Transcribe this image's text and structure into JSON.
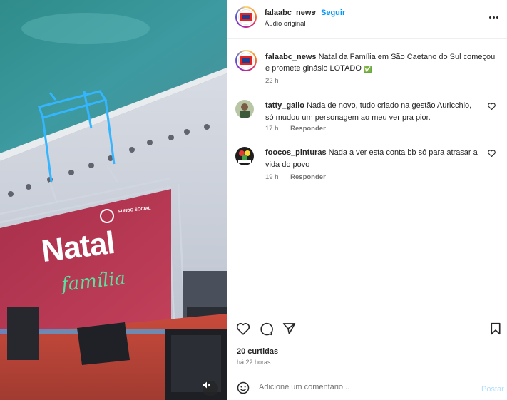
{
  "post": {
    "username": "falaabc_news",
    "separator": "•",
    "follow_label": "Seguir",
    "audio_label": "Áudio original"
  },
  "caption": {
    "username": "falaabc_news",
    "text": "Natal da Família em São Caetano do Sul começou e promete ginásio LOTADO",
    "emoji": "✅",
    "time": "22 h"
  },
  "comments": [
    {
      "username": "tatty_gallo",
      "text": "Nada de novo, tudo criado na gestão Auricchio, só mudou um personagem ao meu ver pra pior.",
      "time": "17 h",
      "reply_label": "Responder"
    },
    {
      "username": "foocos_pinturas",
      "text": "Nada a ver esta conta bb só para atrasar a vida do povo",
      "time": "19 h",
      "reply_label": "Responder"
    }
  ],
  "stats": {
    "likes": "20 curtidas",
    "posted_ago": "há 22 horas"
  },
  "composer": {
    "placeholder": "Adicione um comentário...",
    "post_label": "Postar"
  },
  "media": {
    "banner_title": "Natal",
    "banner_subtitle": "família",
    "banner_org": "FUNDO SOCIAL"
  },
  "icons": {
    "more": "more-options-icon",
    "like": "heart-icon",
    "comment": "comment-icon",
    "share": "share-icon",
    "save": "bookmark-icon",
    "emoji": "emoji-icon",
    "mute": "muted-speaker-icon"
  },
  "colors": {
    "link_blue": "#0095f6",
    "post_disabled": "#b2dffc",
    "banner_red": "#b3344f",
    "stage_red": "#c6463e",
    "light_blue": "#38b8ff"
  }
}
